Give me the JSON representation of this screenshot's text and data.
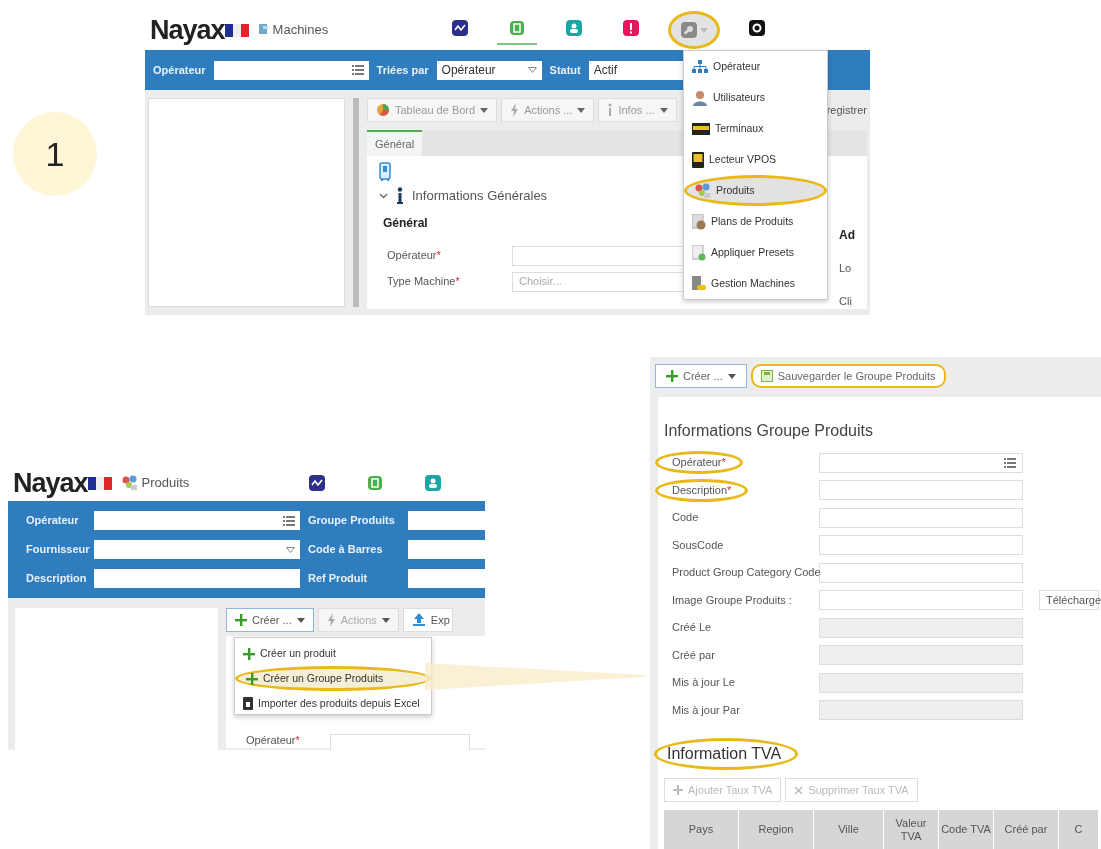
{
  "step": {
    "number": "1"
  },
  "machines": {
    "logo": "Nayax",
    "page": "Machines",
    "nav": [
      {
        "selected": false,
        "highlighted": false
      },
      {
        "selected": true,
        "highlighted": false
      },
      {
        "selected": false,
        "highlighted": false
      },
      {
        "selected": false,
        "highlighted": false
      },
      {
        "selected": false,
        "highlighted": true,
        "expanded": true
      },
      {
        "selected": false,
        "highlighted": false
      }
    ],
    "filters": [
      {
        "label": "Opérateur",
        "kind": "list"
      },
      {
        "label": "Triées par",
        "kind": "select",
        "value": "Opérateur"
      },
      {
        "label": "Statut",
        "kind": "select",
        "value": "Actif"
      }
    ],
    "toolbar": [
      {
        "label": "Tableau de Bord"
      },
      {
        "label": "Actions ..."
      },
      {
        "label": "Infos ..."
      },
      {
        "label": "registrer"
      }
    ],
    "tabs": [
      {
        "label": "Général",
        "selected": true
      }
    ],
    "section": {
      "title": "Informations Générales",
      "expanded": true
    },
    "group": "Général",
    "fields": [
      {
        "label": "Opérateur",
        "mark": "*"
      },
      {
        "label": "Type Machine",
        "mark": "*",
        "placeholder": "Choisir..."
      }
    ],
    "column_2": {
      "heading": "Ad",
      "labels": [
        "Lo",
        "Cli"
      ]
    },
    "menu": [
      {
        "label": "Opérateur",
        "selected": false,
        "highlighted": false
      },
      {
        "label": "Utilisateurs",
        "selected": false,
        "highlighted": false
      },
      {
        "label": "Terminaux",
        "selected": false,
        "highlighted": false
      },
      {
        "label": "Lecteur VPOS",
        "selected": false,
        "highlighted": false
      },
      {
        "label": "Produits",
        "selected": true,
        "highlighted": true
      },
      {
        "label": "Plans de Produits",
        "selected": false,
        "highlighted": false
      },
      {
        "label": "Appliquer Presets",
        "selected": false,
        "highlighted": false
      },
      {
        "label": "Gestion Machines",
        "selected": false,
        "highlighted": false
      }
    ]
  },
  "products": {
    "logo": "Nayax",
    "page": "Produits",
    "nav": [
      {
        "selected": false
      },
      {
        "selected": false
      },
      {
        "selected": false
      }
    ],
    "filters": [
      {
        "label": "Opérateur",
        "kind": "list"
      },
      {
        "label": "Groupe Produits",
        "kind": "text"
      },
      {
        "label": "Fournisseur",
        "kind": "select"
      },
      {
        "label": "Code à Barres",
        "kind": "text"
      },
      {
        "label": "Description",
        "kind": "text"
      },
      {
        "label": "Ref Produit",
        "kind": "text"
      }
    ],
    "toolbar": [
      {
        "label": "Créer ...",
        "expanded": true
      },
      {
        "label": "Actions",
        "expanded": false
      },
      {
        "label": "Exp"
      }
    ],
    "menu": [
      {
        "label": "Créer un produit",
        "selected": false,
        "highlighted": false
      },
      {
        "label": "Créer un Groupe Produits",
        "selected": true,
        "highlighted": true
      },
      {
        "label": "Importer des produits depuis Excel",
        "selected": false,
        "highlighted": false
      }
    ],
    "fields": [
      {
        "label": "Opérateur",
        "mark": "*"
      }
    ]
  },
  "group_form": {
    "toolbar": [
      {
        "label": "Créer ...",
        "highlighted": false
      },
      {
        "label": "Sauvegarder le Groupe Produits",
        "highlighted": true
      }
    ],
    "title": "Informations Groupe Produits",
    "fields": [
      {
        "label": "Opérateur",
        "mark": "*",
        "kind": "list",
        "highlighted": true
      },
      {
        "label": "Description",
        "mark": "*",
        "kind": "text",
        "highlighted": true
      },
      {
        "label": "Code",
        "kind": "text",
        "highlighted": false
      },
      {
        "label": "SousCode",
        "kind": "text",
        "highlighted": false
      },
      {
        "label": "Product Group Category Code",
        "kind": "text",
        "highlighted": false
      },
      {
        "label": "Image Groupe Produits :",
        "kind": "file",
        "button": "Télécharge",
        "highlighted": false
      },
      {
        "label": "Créé Le",
        "kind": "readonly",
        "highlighted": false
      },
      {
        "label": "Créé par",
        "kind": "readonly",
        "highlighted": false
      },
      {
        "label": "Mis à jour Le",
        "kind": "readonly",
        "highlighted": false
      },
      {
        "label": "Mis à jour Par",
        "kind": "readonly",
        "highlighted": false
      }
    ],
    "vat": {
      "title": "Information TVA",
      "highlighted": true,
      "buttons": [
        {
          "label": "Ajouter Taux TVA",
          "disabled": true
        },
        {
          "label": "Supprimer Taux TVA",
          "disabled": true
        }
      ],
      "columns": [
        "Pays",
        "Region",
        "Ville",
        "Valeur TVA",
        "Code TVA",
        "Créé par",
        "C"
      ]
    }
  }
}
